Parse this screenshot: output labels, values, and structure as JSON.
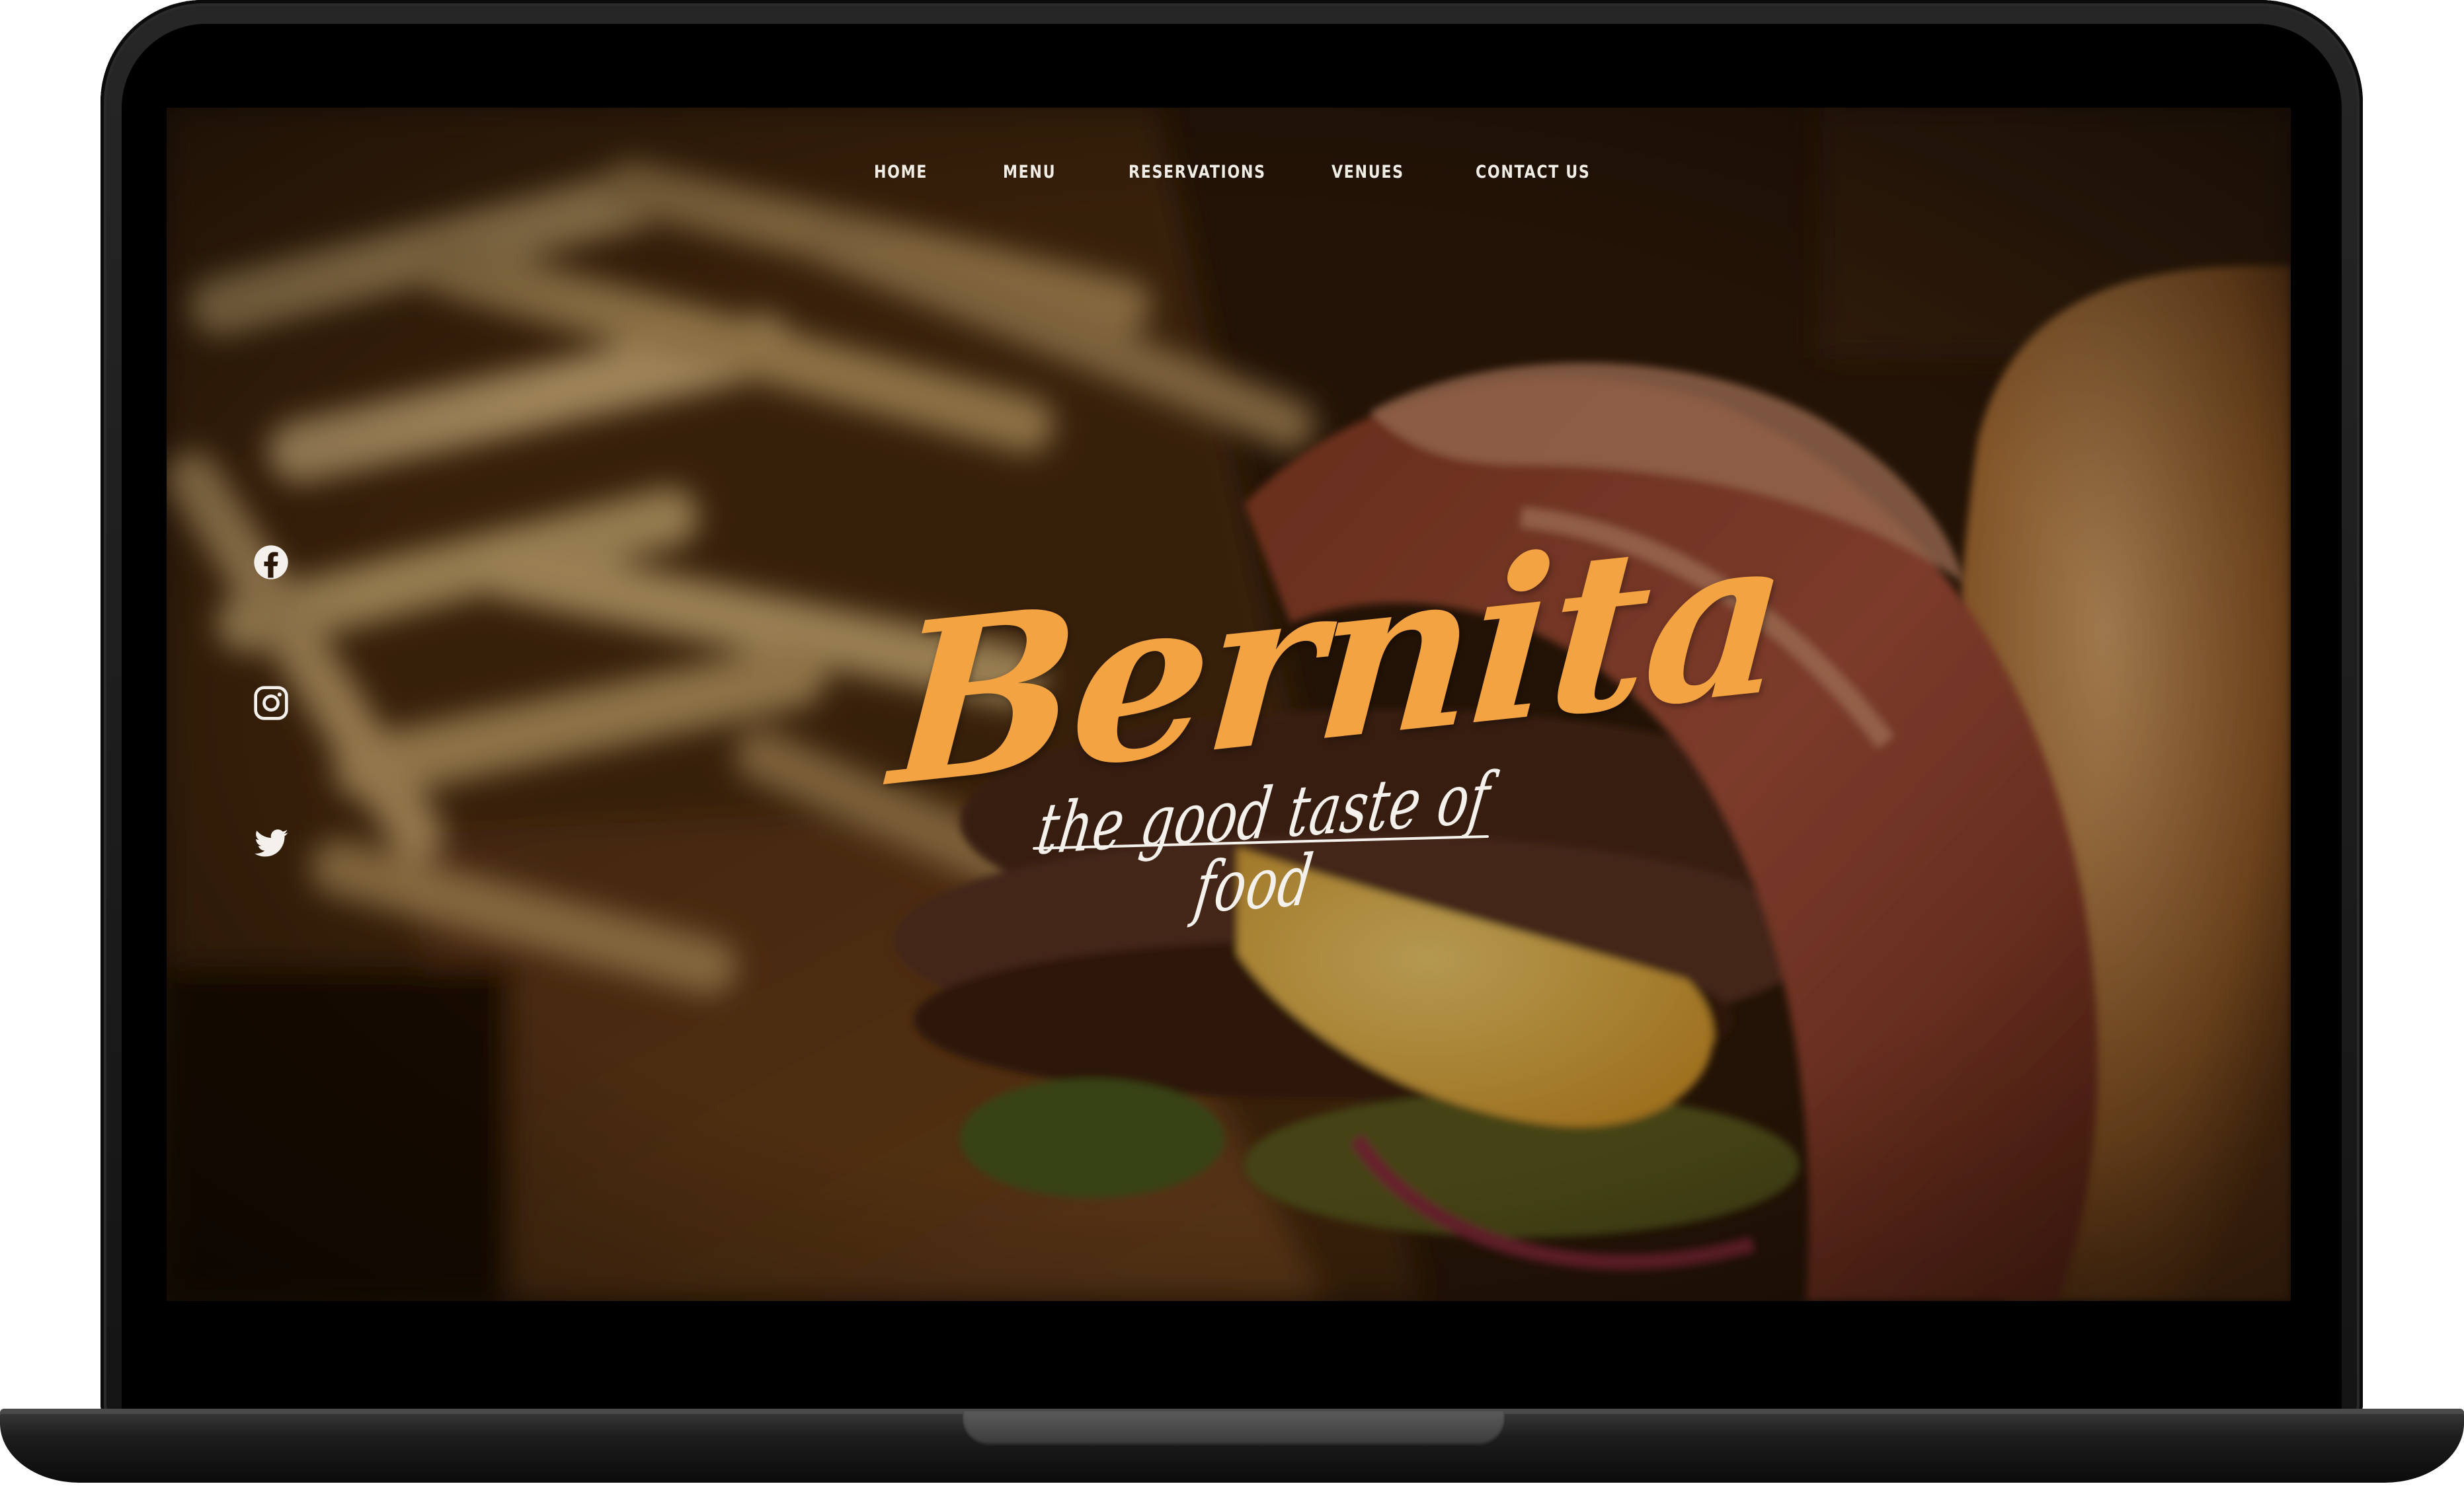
{
  "nav": {
    "items": [
      {
        "label": "HOME"
      },
      {
        "label": "MENU"
      },
      {
        "label": "RESERVATIONS"
      },
      {
        "label": "VENUES"
      },
      {
        "label": "CONTACT US"
      }
    ]
  },
  "social": {
    "icons": [
      "facebook-icon",
      "instagram-icon",
      "twitter-icon"
    ]
  },
  "hero": {
    "brand": "Bernita",
    "tagline": "the good taste of food"
  },
  "colors": {
    "brand_accent": "#f3a341",
    "nav_text": "#f0ece6",
    "frame": "#1a1a1a"
  }
}
